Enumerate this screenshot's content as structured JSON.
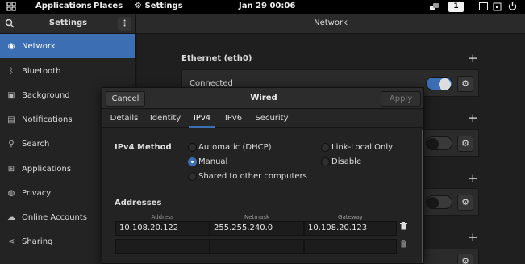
{
  "topbar": {
    "applications": "Applications",
    "places": "Places",
    "settings_app": "Settings",
    "clock": "Jan 29  00:06",
    "workspace": "1"
  },
  "header": {
    "title": "Settings",
    "panel_title": "Network"
  },
  "sidebar": {
    "items": [
      {
        "label": "Network",
        "icon": "network-icon",
        "active": true
      },
      {
        "label": "Bluetooth",
        "icon": "bluetooth-icon"
      },
      {
        "label": "Background",
        "icon": "background-icon"
      },
      {
        "label": "Notifications",
        "icon": "bell-icon"
      },
      {
        "label": "Search",
        "icon": "search-icon"
      },
      {
        "label": "Applications",
        "icon": "grid-icon"
      },
      {
        "label": "Privacy",
        "icon": "privacy-icon"
      },
      {
        "label": "Online Accounts",
        "icon": "cloud-icon"
      },
      {
        "label": "Sharing",
        "icon": "share-icon"
      }
    ]
  },
  "network": {
    "ethernet_title": "Ethernet (eth0)",
    "ethernet_status": "Connected"
  },
  "dialog": {
    "cancel": "Cancel",
    "title": "Wired",
    "apply": "Apply",
    "tabs": [
      "Details",
      "Identity",
      "IPv4",
      "IPv6",
      "Security"
    ],
    "active_tab": "IPv4",
    "method_label": "IPv4 Method",
    "methods": {
      "automatic": "Automatic (DHCP)",
      "manual": "Manual",
      "shared": "Shared to other computers",
      "link_local": "Link-Local Only",
      "disable": "Disable"
    },
    "selected_method": "Manual",
    "addresses_label": "Addresses",
    "columns": {
      "address": "Address",
      "netmask": "Netmask",
      "gateway": "Gateway"
    },
    "rows": [
      {
        "address": "10.108.20.122",
        "netmask": "255.255.240.0",
        "gateway": "10.108.20.123"
      },
      {
        "address": "",
        "netmask": "",
        "gateway": ""
      }
    ]
  },
  "colors": {
    "accent": "#3c6eb4",
    "sidebar_bg": "#232323",
    "topbar_bg": "#000000"
  }
}
